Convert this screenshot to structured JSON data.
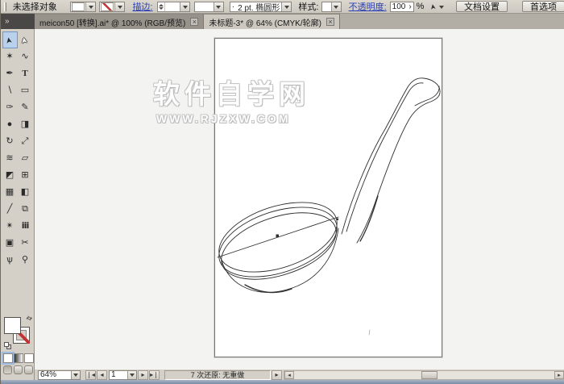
{
  "control_bar": {
    "selection_status": "未选择对象",
    "stroke_label": "描边:",
    "brush_bullet": "·",
    "brush_name": "2 pt. 椭圆形",
    "style_label": "样式:",
    "opacity_label": "不透明度:",
    "opacity_value": "100",
    "opacity_spinner": "›",
    "opacity_unit": "%",
    "cursor_glyph": "➤",
    "document_setup_label": "文档设置",
    "preferences_label": "首选项"
  },
  "tabs": [
    {
      "label": "meicon50 [转换].ai* @ 100% (RGB/预览)"
    },
    {
      "label": "未标题-3* @ 64% (CMYK/轮廓)"
    }
  ],
  "icons": {
    "collapse": "»",
    "close": "×",
    "swap": "⇄",
    "nav_first": "❘◂",
    "nav_prev": "◂",
    "nav_next": "▸",
    "nav_last": "▸❘",
    "status_pop": "▸",
    "scroll_left": "◂",
    "scroll_right": "▸"
  },
  "toolbar": {
    "tools": [
      {
        "name": "selection-tool",
        "glyph": "➤",
        "selected": true
      },
      {
        "name": "direct-selection-tool",
        "glyph": "➤"
      },
      {
        "name": "magic-wand-tool",
        "glyph": "✶"
      },
      {
        "name": "lasso-tool",
        "glyph": "∿"
      },
      {
        "name": "pen-tool",
        "glyph": "✒"
      },
      {
        "name": "type-tool",
        "glyph": "T"
      },
      {
        "name": "line-tool",
        "glyph": "∖"
      },
      {
        "name": "rectangle-tool",
        "glyph": "▭"
      },
      {
        "name": "paintbrush-tool",
        "glyph": "✑"
      },
      {
        "name": "pencil-tool",
        "glyph": "✎"
      },
      {
        "name": "blob-brush-tool",
        "glyph": "●"
      },
      {
        "name": "eraser-tool",
        "glyph": "◨"
      },
      {
        "name": "rotate-tool",
        "glyph": "↻"
      },
      {
        "name": "scale-tool",
        "glyph": "⤢"
      },
      {
        "name": "width-tool",
        "glyph": "≋"
      },
      {
        "name": "free-transform-tool",
        "glyph": "▱"
      },
      {
        "name": "shape-builder-tool",
        "glyph": "◩"
      },
      {
        "name": "perspective-grid-tool",
        "glyph": "⊞"
      },
      {
        "name": "mesh-tool",
        "glyph": "▦"
      },
      {
        "name": "gradient-tool",
        "glyph": "◧"
      },
      {
        "name": "eyedropper-tool",
        "glyph": "╱"
      },
      {
        "name": "blend-tool",
        "glyph": "⧉"
      },
      {
        "name": "symbol-sprayer-tool",
        "glyph": "✴"
      },
      {
        "name": "column-graph-tool",
        "glyph": "ⅲ"
      },
      {
        "name": "artboard-tool",
        "glyph": "▣"
      },
      {
        "name": "slice-tool",
        "glyph": "✂"
      },
      {
        "name": "hand-tool",
        "glyph": "ѱ"
      },
      {
        "name": "zoom-tool",
        "glyph": "⚲"
      }
    ]
  },
  "canvas": {
    "watermark_line1": "软件自学网",
    "watermark_line2": "WWW.RJZXW.COM"
  },
  "status_bar": {
    "zoom_value": "64%",
    "page_number": "1",
    "history_status": "7 次还原: 无重做"
  },
  "colors": {
    "chrome_gray": "#d4d0c8",
    "link_blue": "#2b3fb0",
    "selection_highlight": "#b9d1ec",
    "none_slash_red": "#c43434",
    "artwork_stroke": "#2e2e2e"
  }
}
